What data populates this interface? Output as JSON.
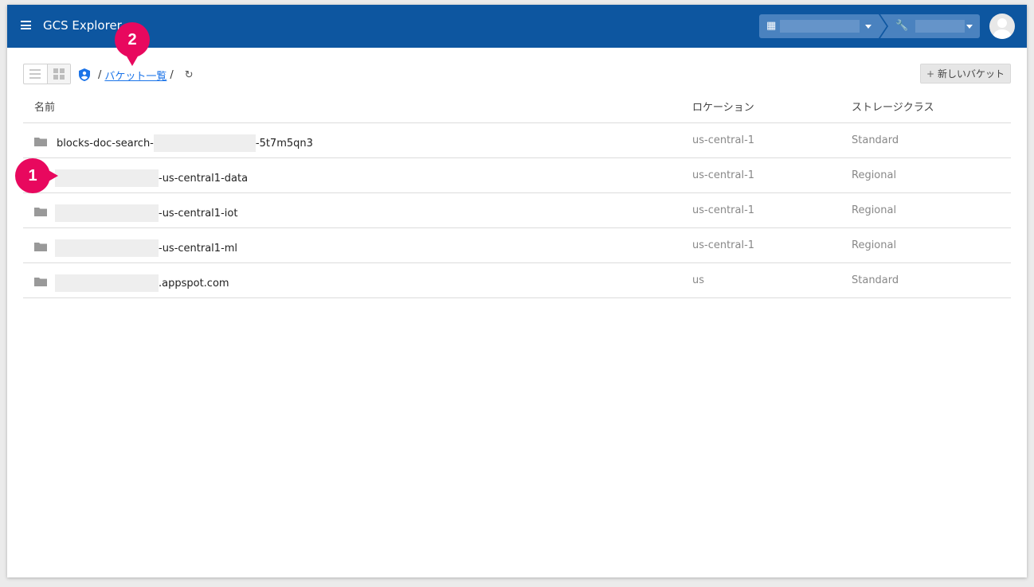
{
  "app": {
    "title": "GCS Explorer"
  },
  "header": {
    "org_icon": "building-icon",
    "project_icon": "wrench-icon"
  },
  "breadcrumb": {
    "sep1": "/",
    "link": "バケット一覧",
    "sep2": "/"
  },
  "toolbar": {
    "new_bucket_label": "新しいバケット",
    "new_bucket_plus": "+"
  },
  "table": {
    "headers": {
      "name": "名前",
      "location": "ロケーション",
      "storage_class": "ストレージクラス"
    },
    "rows": [
      {
        "prefix": "blocks-doc-search-",
        "suffix": "-5t7m5qn3",
        "location": "us-central-1",
        "storage_class": "Standard"
      },
      {
        "prefix": "",
        "suffix": "-us-central1-data",
        "location": "us-central-1",
        "storage_class": "Regional"
      },
      {
        "prefix": "",
        "suffix": "-us-central1-iot",
        "location": "us-central-1",
        "storage_class": "Regional"
      },
      {
        "prefix": "",
        "suffix": "-us-central1-ml",
        "location": "us-central-1",
        "storage_class": "Regional"
      },
      {
        "prefix": "",
        "suffix": ".appspot.com",
        "location": "us",
        "storage_class": "Standard"
      }
    ]
  },
  "annotations": {
    "badge1": "1",
    "badge2": "2"
  },
  "colors": {
    "header_bg": "#0d56a0",
    "link": "#1a73e8",
    "badge": "#e8085e"
  }
}
